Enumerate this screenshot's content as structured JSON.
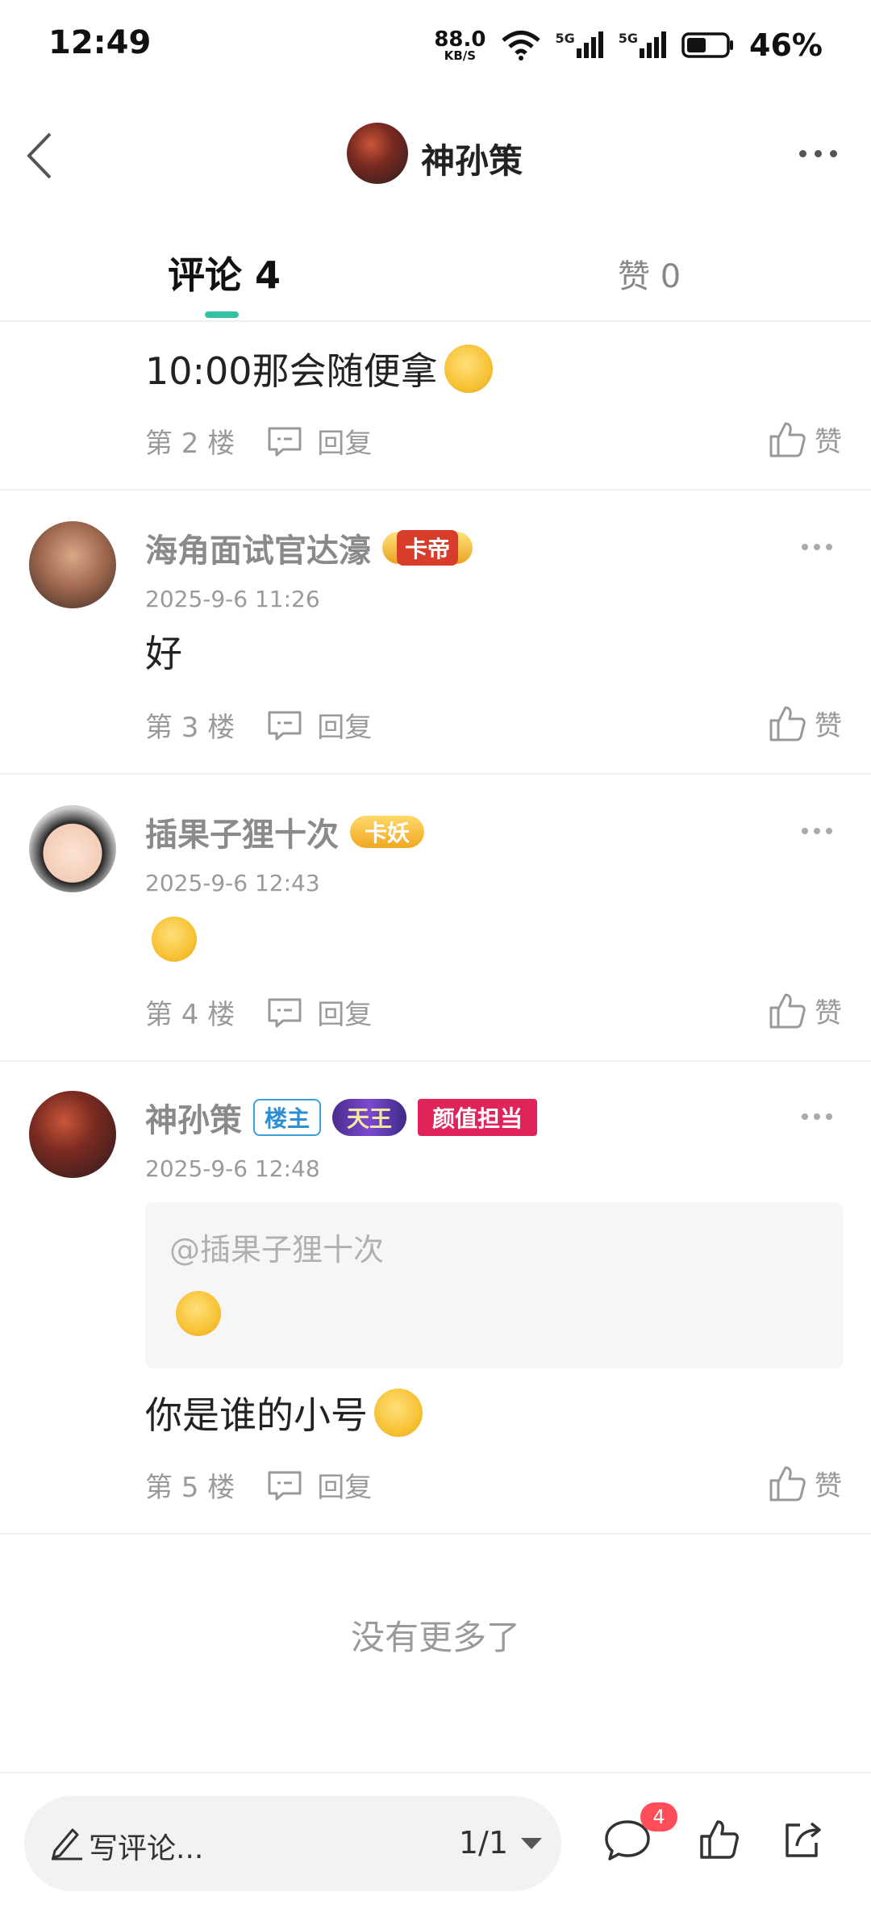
{
  "status": {
    "time": "12:49",
    "net_speed": "88.0",
    "net_unit": "KB/S",
    "sig1": "5G",
    "sig2": "5G",
    "battery": "46%"
  },
  "header": {
    "title": "神孙策"
  },
  "tabs": {
    "comments": "评论 4",
    "likes": "赞 0"
  },
  "comments": [
    {
      "text": "10:00那会随便拿",
      "floor": "第 2 楼",
      "reply": "回复",
      "like": "赞"
    },
    {
      "user": "海角面试官达濠",
      "badge": "卡帝",
      "time": "2025-9-6 11:26",
      "text": "好",
      "floor": "第 3 楼",
      "reply": "回复",
      "like": "赞"
    },
    {
      "user": "插果子狸十次",
      "badge": "卡妖",
      "time": "2025-9-6 12:43",
      "text": "",
      "floor": "第 4 楼",
      "reply": "回复",
      "like": "赞"
    },
    {
      "user": "神孙策",
      "badge_owner": "楼主",
      "badge_title": "天王",
      "badge_extra": "颜值担当",
      "time": "2025-9-6 12:48",
      "quote_user": "@插果子狸十次",
      "text": "你是谁的小号",
      "floor": "第 5 楼",
      "reply": "回复",
      "like": "赞"
    }
  ],
  "no_more": "没有更多了",
  "bottom": {
    "placeholder": "写评论...",
    "page": "1/1",
    "comment_count": "4"
  }
}
